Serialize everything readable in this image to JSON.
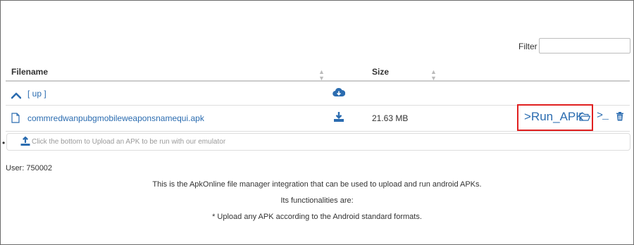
{
  "filter": {
    "label": "Filter",
    "value": ""
  },
  "table": {
    "headers": {
      "filename": "Filename",
      "size": "Size"
    },
    "up_row": {
      "label": "[ up ]"
    },
    "file_row": {
      "name": "commredwanpubgmobileweaponsnamequi.apk",
      "size": "21.63 MB",
      "run_label": ">Run_APK",
      "terminal_label": ">_"
    }
  },
  "upload": {
    "text": "Click the bottom to Upload an APK to be run with our emulator"
  },
  "user": "User: 750002",
  "info": {
    "line1": "This is the ApkOnline file manager integration that can be used to upload and run android APKs.",
    "line2": "Its functionalities are:",
    "line3": "* Upload any APK according to the Android standard formats."
  },
  "colors": {
    "accent": "#2b6cb0",
    "highlight": "#e02020"
  },
  "icons": [
    "chevron-up-icon",
    "cloud-download-icon",
    "file-icon",
    "download-icon",
    "folder-open-icon",
    "terminal-icon",
    "trash-icon",
    "upload-icon",
    "sort-icon"
  ]
}
